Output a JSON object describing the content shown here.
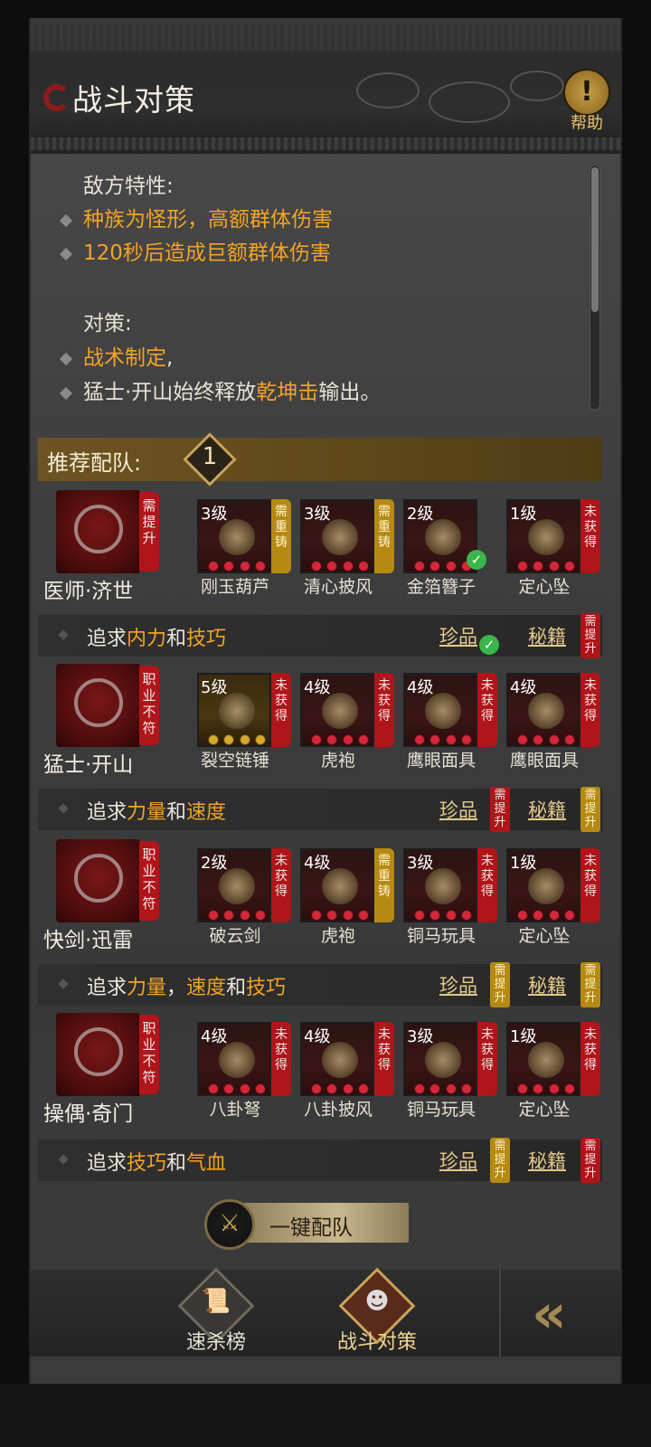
{
  "header": {
    "title": "战斗对策",
    "help_label": "帮助",
    "help_icon": "exclamation-icon"
  },
  "info": {
    "enemy_title": "敌方特性:",
    "enemy_traits": [
      "种族为怪形，高额群体伤害",
      "120秒后造成巨额群体伤害"
    ],
    "counter_title": "对策:",
    "counter_1_highlight": "战术制定",
    "counter_1_rest": ",",
    "counter_2_prefix": "猛士·开山始终释放",
    "counter_2_highlight": "乾坤击",
    "counter_2_suffix": "输出。"
  },
  "recommend": {
    "label": "推荐配队:",
    "number": "1"
  },
  "teams": [
    {
      "hero": "医师·济世",
      "hero_tag": "需提升",
      "items": [
        {
          "level": "3级",
          "name": "刚玉葫芦",
          "tag": "需重铸",
          "tag_color": "yellow",
          "checked": false
        },
        {
          "level": "3级",
          "name": "清心披风",
          "tag": "需重铸",
          "tag_color": "yellow",
          "checked": false
        },
        {
          "level": "2级",
          "name": "金箔簪子",
          "tag": "",
          "tag_color": "",
          "checked": true
        },
        {
          "level": "1级",
          "name": "定心坠",
          "tag": "未获得",
          "tag_color": "red",
          "checked": false
        }
      ],
      "pursue_prefix": "追求",
      "pursue_a": "内力",
      "pursue_mid": "和",
      "pursue_b": "技巧",
      "pursue_mid2": "",
      "pursue_c": "",
      "treasure": "珍品",
      "treasure_tag": "",
      "treasure_checked": true,
      "book": "秘籍",
      "book_tag": "需提升",
      "book_tag_color": "red"
    },
    {
      "hero": "猛士·开山",
      "hero_tag": "职业不符",
      "items": [
        {
          "level": "5级",
          "name": "裂空链锤",
          "tag": "未获得",
          "tag_color": "red",
          "checked": false
        },
        {
          "level": "4级",
          "name": "虎袍",
          "tag": "未获得",
          "tag_color": "red",
          "checked": false
        },
        {
          "level": "4级",
          "name": "鹰眼面具",
          "tag": "未获得",
          "tag_color": "red",
          "checked": false
        },
        {
          "level": "4级",
          "name": "鹰眼面具",
          "tag": "未获得",
          "tag_color": "red",
          "checked": false
        }
      ],
      "pursue_prefix": "追求",
      "pursue_a": "力量",
      "pursue_mid": "和",
      "pursue_b": "速度",
      "pursue_mid2": "",
      "pursue_c": "",
      "treasure": "珍品",
      "treasure_tag": "需提升",
      "treasure_tag_color": "red",
      "treasure_checked": false,
      "book": "秘籍",
      "book_tag": "需提升",
      "book_tag_color": "yellow"
    },
    {
      "hero": "快剑·迅雷",
      "hero_tag": "职业不符",
      "items": [
        {
          "level": "2级",
          "name": "破云剑",
          "tag": "未获得",
          "tag_color": "red",
          "checked": false
        },
        {
          "level": "4级",
          "name": "虎袍",
          "tag": "需重铸",
          "tag_color": "yellow",
          "checked": false
        },
        {
          "level": "3级",
          "name": "铜马玩具",
          "tag": "未获得",
          "tag_color": "red",
          "checked": false
        },
        {
          "level": "1级",
          "name": "定心坠",
          "tag": "未获得",
          "tag_color": "red",
          "checked": false
        }
      ],
      "pursue_prefix": "追求",
      "pursue_a": "力量",
      "pursue_mid": "，",
      "pursue_b": "速度",
      "pursue_mid2": "和",
      "pursue_c": "技巧",
      "treasure": "珍品",
      "treasure_tag": "需提升",
      "treasure_tag_color": "yellow",
      "treasure_checked": false,
      "book": "秘籍",
      "book_tag": "需提升",
      "book_tag_color": "yellow"
    },
    {
      "hero": "操偶·奇门",
      "hero_tag": "职业不符",
      "items": [
        {
          "level": "4级",
          "name": "八卦弩",
          "tag": "未获得",
          "tag_color": "red",
          "checked": false
        },
        {
          "level": "4级",
          "name": "八卦披风",
          "tag": "未获得",
          "tag_color": "red",
          "checked": false
        },
        {
          "level": "3级",
          "name": "铜马玩具",
          "tag": "未获得",
          "tag_color": "red",
          "checked": false
        },
        {
          "level": "1级",
          "name": "定心坠",
          "tag": "未获得",
          "tag_color": "red",
          "checked": false
        }
      ],
      "pursue_prefix": "追求",
      "pursue_a": "技巧",
      "pursue_mid": "和",
      "pursue_b": "气血",
      "pursue_mid2": "",
      "pursue_c": "",
      "treasure": "珍品",
      "treasure_tag": "需提升",
      "treasure_tag_color": "yellow",
      "treasure_checked": false,
      "book": "秘籍",
      "book_tag": "需提升",
      "book_tag_color": "red"
    }
  ],
  "one_key": {
    "label": "一键配队",
    "icon": "shield-sword-icon"
  },
  "nav": {
    "items": [
      {
        "label": "速杀榜",
        "icon": "scroll-icon",
        "active": false
      },
      {
        "label": "战斗对策",
        "icon": "opera-mask-icon",
        "active": true
      }
    ],
    "back_icon": "double-chevron-left-icon"
  },
  "colors": {
    "highlight": "#f2a326",
    "tag_red": "#b0151a",
    "tag_yellow": "#b68a12",
    "rec_bar": "#6d5422"
  }
}
